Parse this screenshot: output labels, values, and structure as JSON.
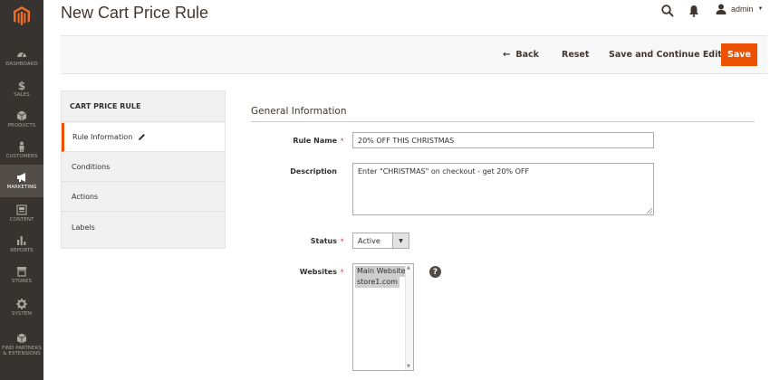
{
  "sidebar": {
    "logo": "magento-logo",
    "items": [
      {
        "label": "DASHBOARD",
        "icon": "dashboard-icon"
      },
      {
        "label": "SALES",
        "icon": "dollar-icon"
      },
      {
        "label": "PRODUCTS",
        "icon": "cube-icon"
      },
      {
        "label": "CUSTOMERS",
        "icon": "person-icon"
      },
      {
        "label": "MARKETING",
        "icon": "megaphone-icon",
        "active": true
      },
      {
        "label": "CONTENT",
        "icon": "content-icon"
      },
      {
        "label": "REPORTS",
        "icon": "bar-chart-icon"
      },
      {
        "label": "STORES",
        "icon": "store-icon"
      },
      {
        "label": "SYSTEM",
        "icon": "gear-icon"
      },
      {
        "label": "FIND PARTNERS & EXTENSIONS",
        "icon": "partners-icon"
      }
    ]
  },
  "header": {
    "title": "New Cart Price Rule",
    "user": "admin"
  },
  "actions": {
    "back": "Back",
    "reset": "Reset",
    "save_continue": "Save and Continue Edit",
    "save": "Save"
  },
  "tabs": {
    "heading": "CART PRICE RULE",
    "items": [
      "Rule Information",
      "Conditions",
      "Actions",
      "Labels"
    ]
  },
  "form": {
    "section_title": "General Information",
    "rule_name": {
      "label": "Rule Name",
      "value": "20% OFF THIS CHRISTMAS",
      "required": true
    },
    "description": {
      "label": "Description",
      "value": "Enter \"CHRISTMAS\" on checkout - get 20% OFF"
    },
    "status": {
      "label": "Status",
      "value": "Active",
      "required": true
    },
    "websites": {
      "label": "Websites",
      "options": [
        "Main Website",
        "store1.com"
      ],
      "required": true
    }
  },
  "colors": {
    "sidebar_bg": "#373330",
    "accent": "#eb5202",
    "required": "#e22626"
  }
}
